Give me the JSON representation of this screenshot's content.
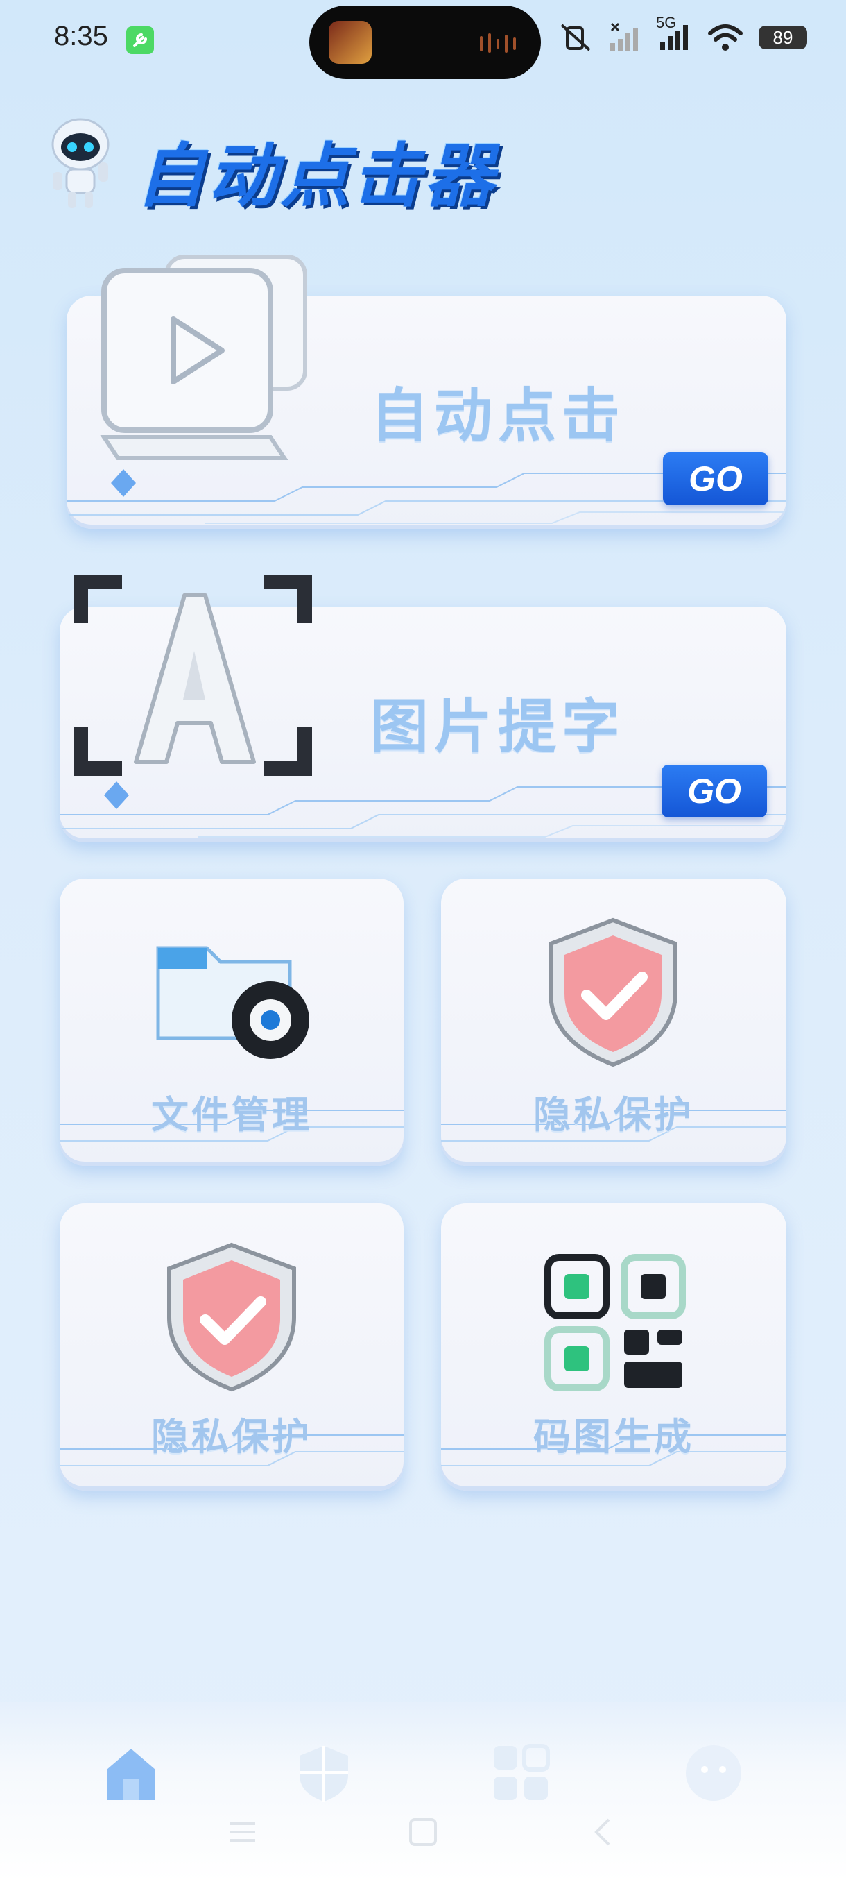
{
  "status_bar": {
    "time": "8:35",
    "network_label": "5G",
    "battery": "89"
  },
  "header": {
    "app_title": "自动点击器"
  },
  "cards": {
    "auto_click": {
      "title": "自动点击",
      "go_label": "GO"
    },
    "image_text": {
      "title": "图片提字",
      "go_label": "GO"
    },
    "file_manage": {
      "title": "文件管理"
    },
    "privacy_1": {
      "title": "隐私保护"
    },
    "privacy_2": {
      "title": "隐私保护"
    },
    "qr_gen": {
      "title": "码图生成"
    }
  },
  "bottom_nav": {
    "items": [
      {
        "icon": "home-icon"
      },
      {
        "icon": "shield-icon"
      },
      {
        "icon": "grid-icon"
      },
      {
        "icon": "face-icon"
      }
    ]
  },
  "colors": {
    "accent": "#1d6fe8",
    "card_title": "#9cc6f2",
    "go_button": "#1f6ae6"
  }
}
